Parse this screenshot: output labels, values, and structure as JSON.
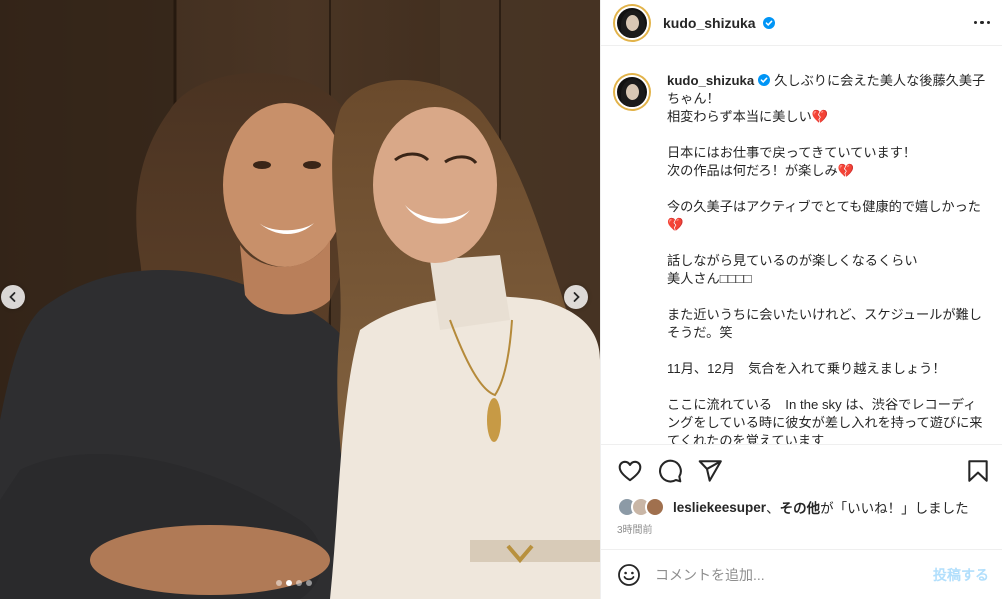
{
  "post": {
    "username": "kudo_shizuka",
    "verified": true,
    "photo_alt": "Two women smiling together",
    "carousel_total": 4,
    "carousel_active": 2
  },
  "caption": {
    "username": "kudo_shizuka",
    "paragraphs": [
      "久しぶりに会えた美人な後藤久美子ちゃん！\n相変わらず本当に美しい💔",
      "日本にはお仕事で戻ってきていています！\n次の作品は何だろ！が楽しみ💔",
      "今の久美子はアクティブでとても健康的で嬉しかった💔",
      "話しながら見ているのが楽しくなるくらい\n美人さん□□□□",
      "また近いうちに会いたいけれど、スケジュールが難しそうだ。笑",
      "11月、12月　気合を入れて乗り越えましょう！",
      "ここに流れている　In the sky は、渋谷でレコーディングをしている時に彼女が差し入れを持って遊びに来てくれたのを覚えています"
    ]
  },
  "likes": {
    "first_liker": "lesliekeesuper",
    "separator": "、",
    "others": "その他",
    "suffix": "が「いいね！」しました"
  },
  "timestamp": "3時間前",
  "comment": {
    "placeholder": "コメントを追加...",
    "post_label": "投稿する"
  },
  "colors": {
    "verified": "#0095f6",
    "post_button": "#b2dffc",
    "heart_emoji": "#d81b3a"
  },
  "icons": {
    "like": "heart-icon",
    "comment": "comment-icon",
    "share": "share-icon",
    "save": "bookmark-icon",
    "emoji": "emoji-icon",
    "more": "more-horizontal-icon",
    "prev": "chevron-left-icon",
    "next": "chevron-right-icon"
  }
}
